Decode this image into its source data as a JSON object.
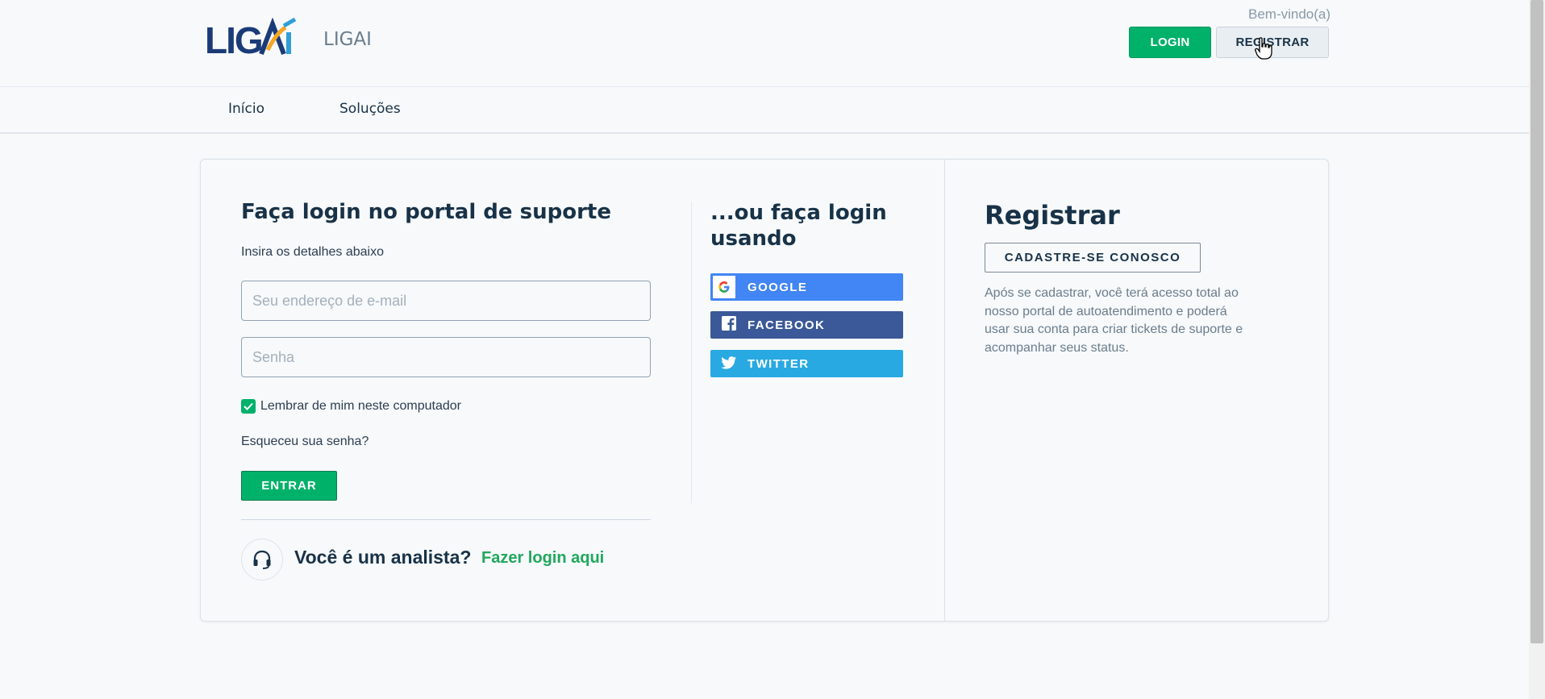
{
  "header": {
    "brand_name": "LIGAI",
    "welcome": "Bem-vindo(a)",
    "login_label": "LOGIN",
    "register_label": "REGISTRAR"
  },
  "nav": {
    "items": [
      {
        "label": "Início"
      },
      {
        "label": "Soluções"
      }
    ]
  },
  "login": {
    "title": "Faça login no portal de suporte",
    "subtitle": "Insira os detalhes abaixo",
    "email_placeholder": "Seu endereço de e-mail",
    "password_placeholder": "Senha",
    "remember_label": "Lembrar de mim neste computador",
    "remember_checked": true,
    "forgot_label": "Esqueceu sua senha?",
    "enter_label": "ENTRAR",
    "analyst_question": "Você é um analista?",
    "analyst_link": "Fazer login aqui"
  },
  "social": {
    "title": "...ou faça login usando",
    "buttons": [
      {
        "label": "GOOGLE",
        "icon": "google-icon",
        "color": "#4285f4"
      },
      {
        "label": "FACEBOOK",
        "icon": "facebook-icon",
        "color": "#3b5998"
      },
      {
        "label": "TWITTER",
        "icon": "twitter-icon",
        "color": "#28a9e2"
      }
    ]
  },
  "register": {
    "title": "Registrar",
    "signup_label": "CADASTRE-SE CONOSCO",
    "description": "Após se cadastrar, você terá acesso total ao nosso portal de autoatendimento e poderá usar sua conta para criar tickets de suporte e acompanhar seus status."
  },
  "colors": {
    "primary": "#00b16a",
    "text": "#183247",
    "background": "#f7f9fb"
  }
}
